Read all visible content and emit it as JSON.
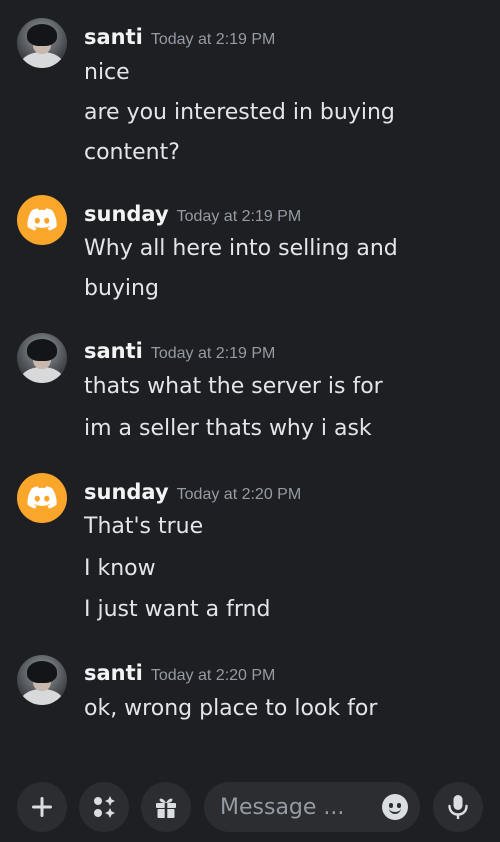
{
  "messages": [
    {
      "author": "santi",
      "timestamp": "Today at 2:19 PM",
      "avatar": "user-photo",
      "lines": [
        "nice",
        "are you interested in buying",
        "content?"
      ]
    },
    {
      "author": "sunday",
      "timestamp": "Today at 2:19 PM",
      "avatar": "discord-default-avatar",
      "lines": [
        "Why all here into selling and",
        "buying"
      ]
    },
    {
      "author": "santi",
      "timestamp": "Today at 2:19 PM",
      "avatar": "user-photo",
      "lines": [
        "thats what the server is for",
        "im a seller thats why i ask"
      ]
    },
    {
      "author": "sunday",
      "timestamp": "Today at 2:20 PM",
      "avatar": "discord-default-avatar",
      "lines": [
        "That's true",
        "I know",
        "I just want a frnd"
      ]
    },
    {
      "author": "santi",
      "timestamp": "Today at 2:20 PM",
      "avatar": "user-photo",
      "lines": [
        "ok, wrong place to look for"
      ]
    }
  ],
  "composer": {
    "placeholder": "Message ...",
    "value": ""
  },
  "icons": {
    "plus": "plus-icon",
    "apps": "apps-icon",
    "gift": "gift-icon",
    "emoji": "emoji-icon",
    "mic": "microphone-icon"
  },
  "colors": {
    "background": "#1e1f22",
    "button_bg": "#2b2d31",
    "discord_avatar": "#f9a62b",
    "text": "#e3e5e8",
    "muted": "#949ba4"
  }
}
